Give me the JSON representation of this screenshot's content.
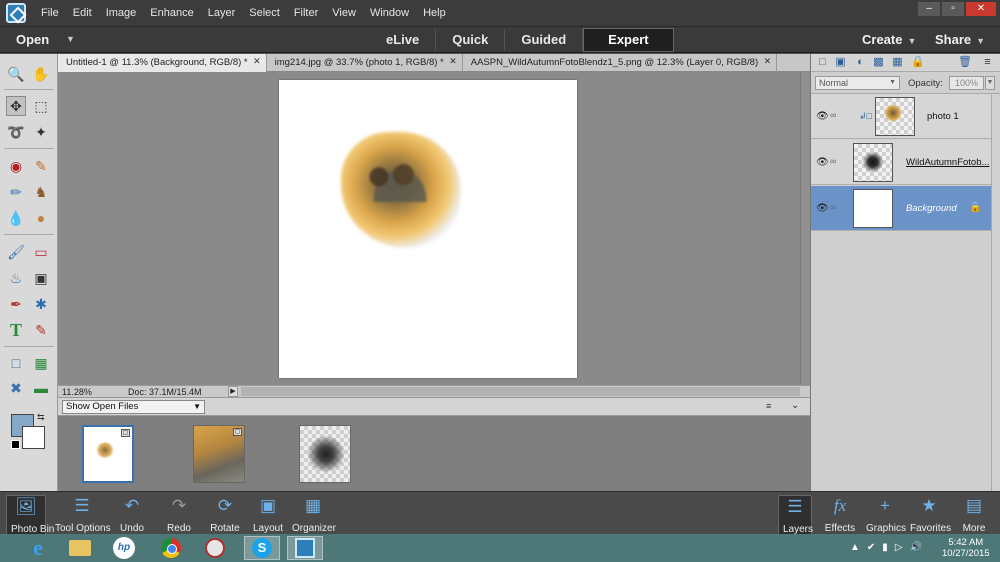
{
  "menubar": {
    "items": [
      "File",
      "Edit",
      "Image",
      "Enhance",
      "Layer",
      "Select",
      "Filter",
      "View",
      "Window",
      "Help"
    ],
    "window_controls": [
      "–",
      "▫",
      "✕"
    ]
  },
  "modebar": {
    "open_label": "Open",
    "modes": [
      "eLive",
      "Quick",
      "Guided",
      "Expert"
    ],
    "active_mode": "Expert",
    "create_label": "Create",
    "share_label": "Share"
  },
  "doc_tabs": [
    {
      "label": "Untitled-1 @ 11.3% (Background, RGB/8) *",
      "active": true
    },
    {
      "label": "img214.jpg @ 33.7% (photo 1, RGB/8) *",
      "active": false
    },
    {
      "label": "AASPN_WildAutumnFotoBlendz1_5.png @ 12.3% (Layer 0, RGB/8)",
      "active": false
    }
  ],
  "status": {
    "zoom": "11.28%",
    "doc_size": "Doc: 37.1M/15.4M"
  },
  "photo_bin": {
    "selector_value": "Show Open Files"
  },
  "colors": {
    "foreground": "#86a8c8",
    "background": "#ffffff",
    "selected_layer": "#6b93c8",
    "accent": "#2d7fb8"
  },
  "layers_panel": {
    "blend_mode": "Normal",
    "opacity_label": "Opacity:",
    "opacity_value": "100%",
    "layers": [
      {
        "name": "photo 1",
        "selected": false
      },
      {
        "name": "WildAutumnFotob...",
        "selected": false
      },
      {
        "name": "Background",
        "selected": true
      }
    ]
  },
  "bottom_bar": {
    "left": [
      "Photo Bin",
      "Tool Options",
      "Undo",
      "Redo",
      "Rotate",
      "Layout",
      "Organizer"
    ],
    "right": [
      "Layers",
      "Effects",
      "Graphics",
      "Favorites",
      "More"
    ]
  },
  "taskbar": {
    "clock_time": "5:42 AM",
    "clock_date": "10/27/2015"
  }
}
